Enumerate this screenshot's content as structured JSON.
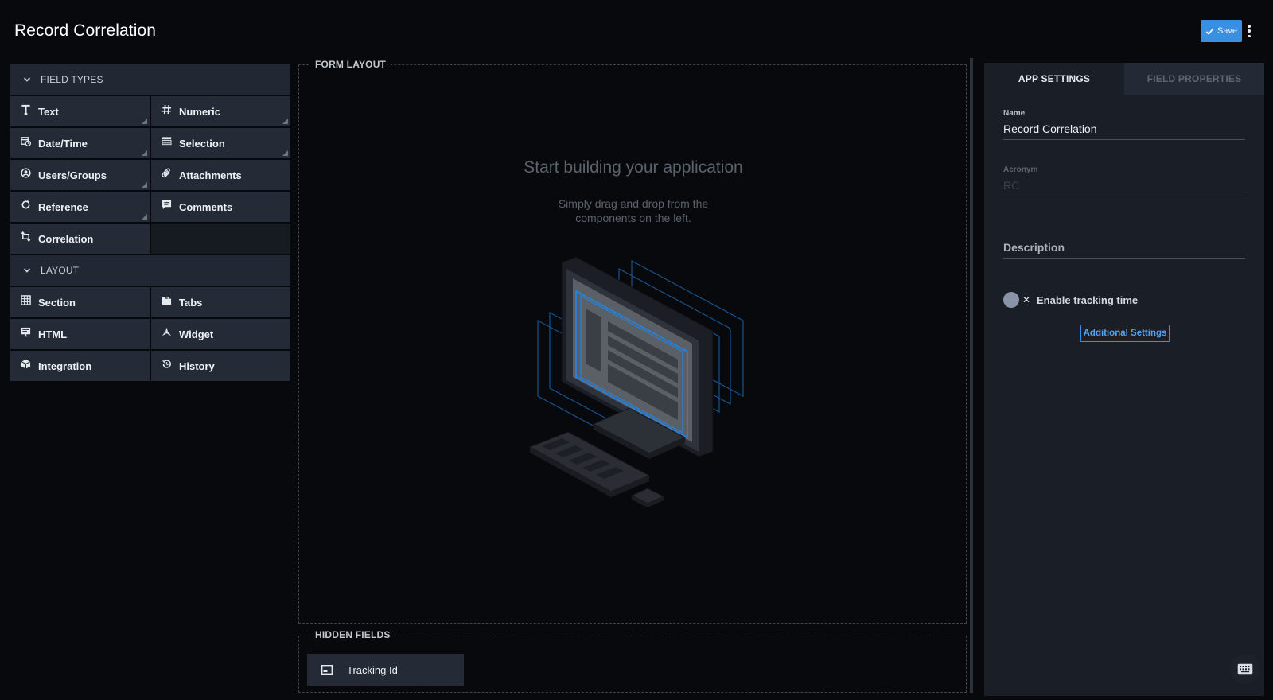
{
  "header": {
    "title": "Record Correlation",
    "save_label": "Save"
  },
  "palette": {
    "field_types_label": "FIELD TYPES",
    "field_types": [
      {
        "label": "Text",
        "icon": "text-icon"
      },
      {
        "label": "Numeric",
        "icon": "hash-icon"
      },
      {
        "label": "Date/Time",
        "icon": "calendar-clock-icon"
      },
      {
        "label": "Selection",
        "icon": "list-icon"
      },
      {
        "label": "Users/Groups",
        "icon": "user-circle-icon"
      },
      {
        "label": "Attachments",
        "icon": "paperclip-icon"
      },
      {
        "label": "Reference",
        "icon": "refresh-icon"
      },
      {
        "label": "Comments",
        "icon": "comment-icon"
      },
      {
        "label": "Correlation",
        "icon": "correlation-icon"
      }
    ],
    "layout_label": "LAYOUT",
    "layout_items": [
      {
        "label": "Section",
        "icon": "grid-icon"
      },
      {
        "label": "Tabs",
        "icon": "tabs-icon"
      },
      {
        "label": "HTML",
        "icon": "html-icon"
      },
      {
        "label": "Widget",
        "icon": "widget-icon"
      },
      {
        "label": "Integration",
        "icon": "cube-icon"
      },
      {
        "label": "History",
        "icon": "history-icon"
      }
    ]
  },
  "form_layout": {
    "label": "FORM LAYOUT",
    "empty_title": "Start building your application",
    "empty_subtitle_line1": "Simply drag and drop from the",
    "empty_subtitle_line2": "components on the left."
  },
  "hidden_fields": {
    "label": "HIDDEN FIELDS",
    "items": [
      {
        "label": "Tracking Id",
        "icon": "tracking-icon"
      }
    ]
  },
  "right_panel": {
    "tabs": [
      {
        "label": "APP SETTINGS",
        "active": true
      },
      {
        "label": "FIELD PROPERTIES",
        "active": false
      }
    ],
    "name_label": "Name",
    "name_value": "Record Correlation",
    "acronym_label": "Acronym",
    "acronym_value": "RC",
    "description_label": "Description",
    "tracking_label": "Enable tracking time",
    "tracking_enabled": false,
    "additional_settings_label": "Additional Settings"
  },
  "colors": {
    "accent": "#3b8fe0",
    "background": "#07090d",
    "panel": "#1a1e26",
    "tile": "#252b36"
  }
}
